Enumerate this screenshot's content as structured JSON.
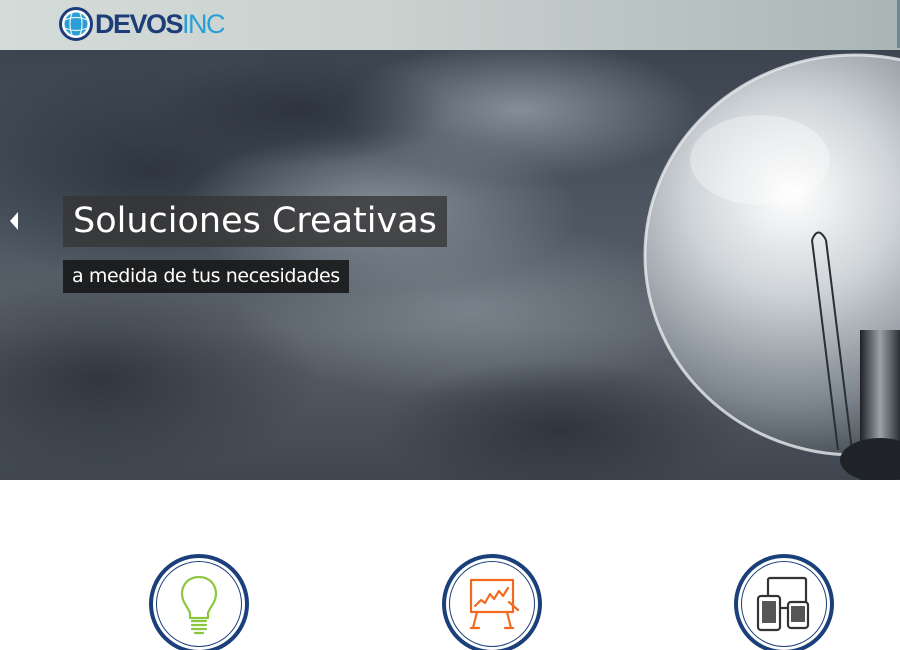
{
  "brand": {
    "name_part1": "DEVOS",
    "name_part2": "INC",
    "colors": {
      "dark_blue": "#1d3d78",
      "light_blue": "#2a9fd6"
    },
    "logo_icon": "globe-icon"
  },
  "hero": {
    "headline": "Soluciones Creativas",
    "subheadline": "a medida de tus necesidades",
    "background_icon": "light-bulb-photo",
    "prev_icon": "arrow-left-icon"
  },
  "services": [
    {
      "icon": "lightbulb-icon",
      "color": "#8cc63f"
    },
    {
      "icon": "presentation-board-icon",
      "color": "#f26a21"
    },
    {
      "icon": "devices-icon",
      "color": "#333333"
    }
  ]
}
